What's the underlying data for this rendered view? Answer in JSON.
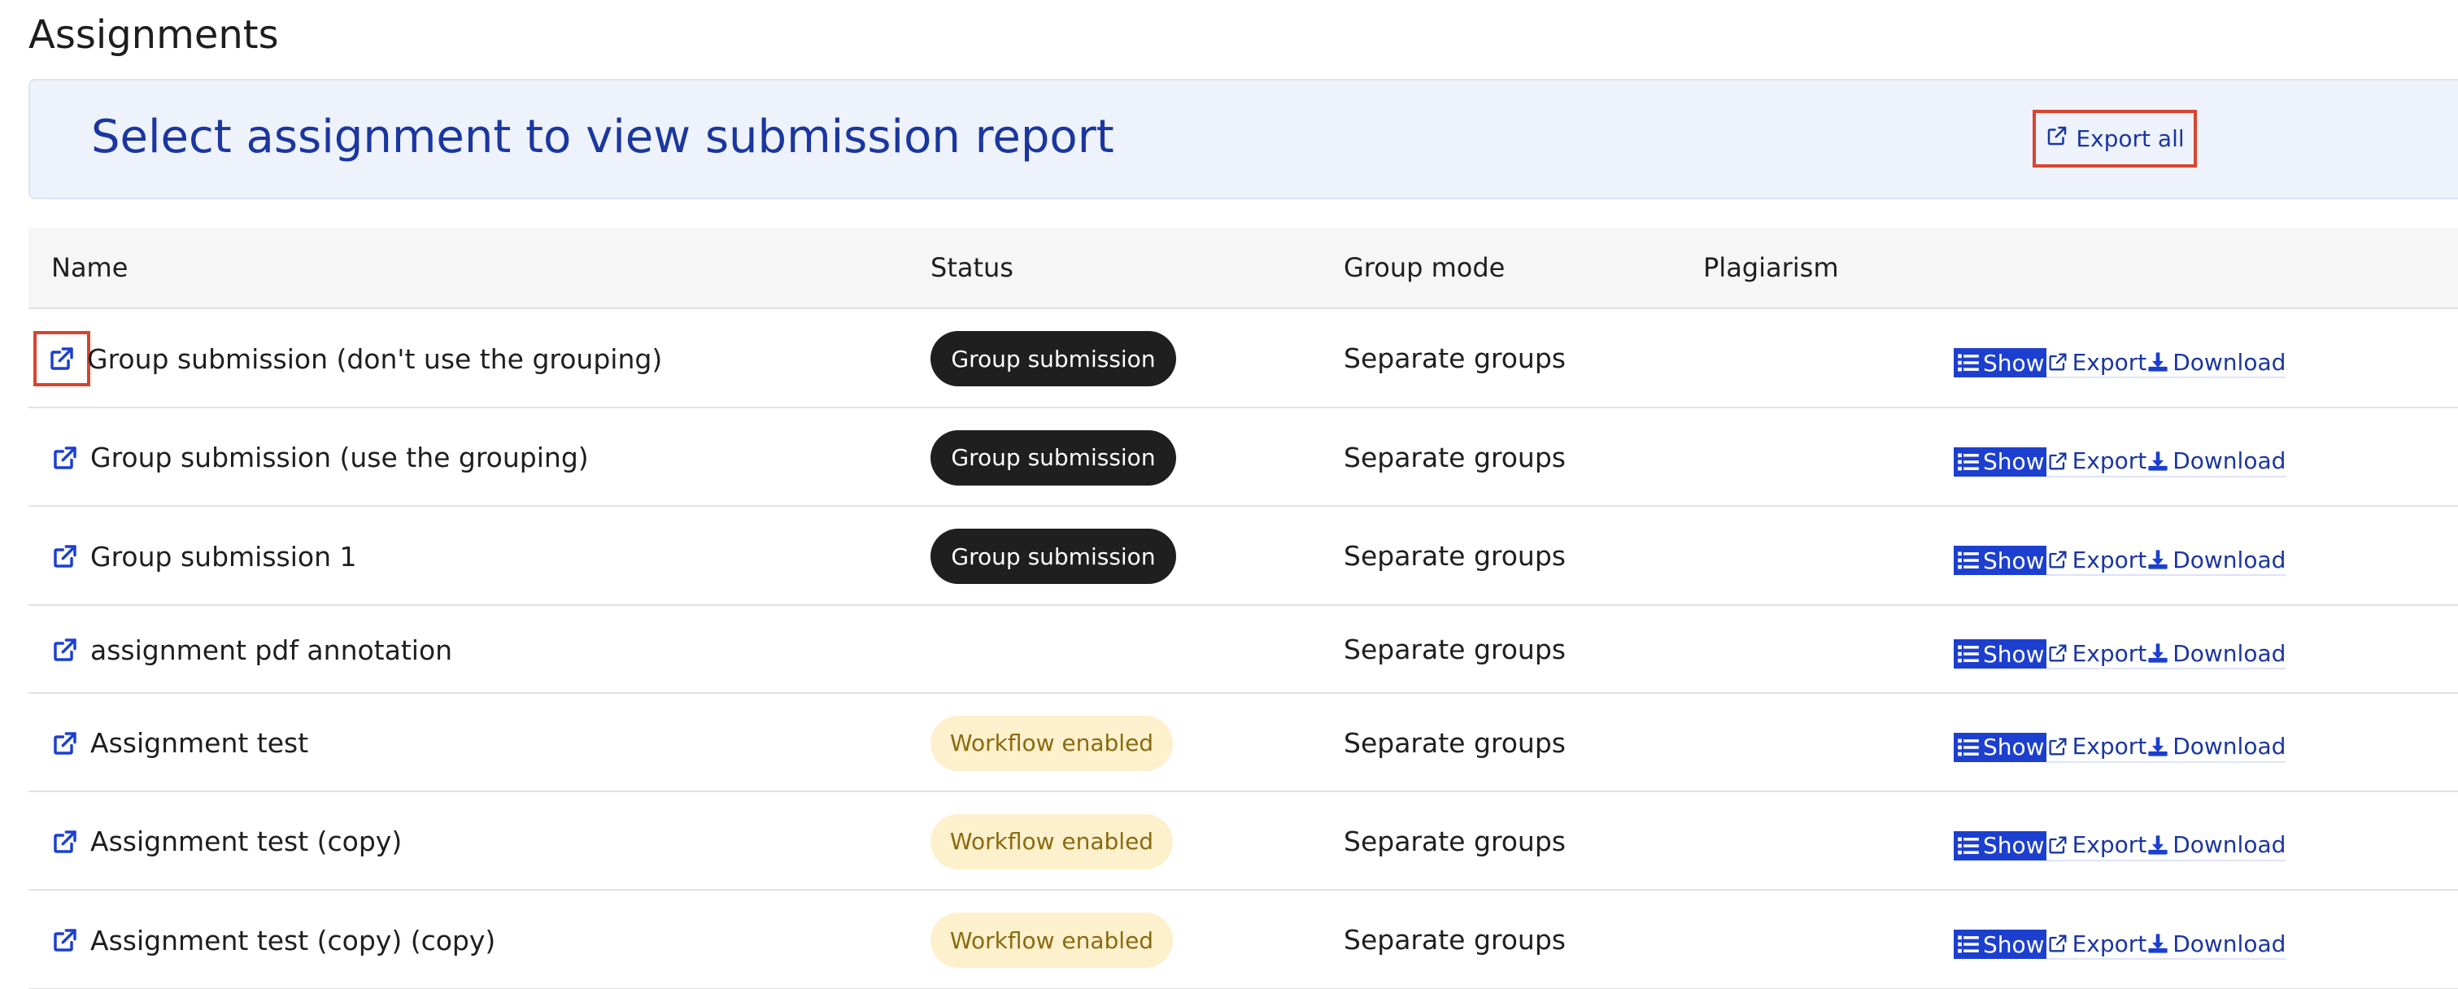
{
  "page": {
    "title": "Assignments"
  },
  "banner": {
    "title": "Select assignment to view submission report",
    "export_all_label": "Export all"
  },
  "table": {
    "headers": {
      "name": "Name",
      "status": "Status",
      "group_mode": "Group mode",
      "plagiarism": "Plagiarism"
    },
    "action_labels": {
      "show": "Show",
      "export": "Export",
      "download": "Download"
    },
    "rows": [
      {
        "name": "Group submission (don't use the grouping)",
        "status": "Group submission",
        "status_type": "dark",
        "group_mode": "Separate groups",
        "plagiarism": ""
      },
      {
        "name": "Group submission (use the grouping)",
        "status": "Group submission",
        "status_type": "dark",
        "group_mode": "Separate groups",
        "plagiarism": ""
      },
      {
        "name": "Group submission 1",
        "status": "Group submission",
        "status_type": "dark",
        "group_mode": "Separate groups",
        "plagiarism": ""
      },
      {
        "name": "assignment pdf annotation",
        "status": "",
        "status_type": "none",
        "group_mode": "Separate groups",
        "plagiarism": ""
      },
      {
        "name": "Assignment test",
        "status": "Workflow enabled",
        "status_type": "warn",
        "group_mode": "Separate groups",
        "plagiarism": ""
      },
      {
        "name": "Assignment test (copy)",
        "status": "Workflow enabled",
        "status_type": "warn",
        "group_mode": "Separate groups",
        "plagiarism": ""
      },
      {
        "name": "Assignment test (copy) (copy)",
        "status": "Workflow enabled",
        "status_type": "warn",
        "group_mode": "Separate groups",
        "plagiarism": ""
      }
    ]
  },
  "colors": {
    "accent": "#1a36a0",
    "show_button": "#1c3fcf",
    "highlight": "#d9442f",
    "badge_dark": "#1f1f1f",
    "badge_warn_bg": "#fdf0cc",
    "badge_warn_text": "#8a6a10"
  }
}
